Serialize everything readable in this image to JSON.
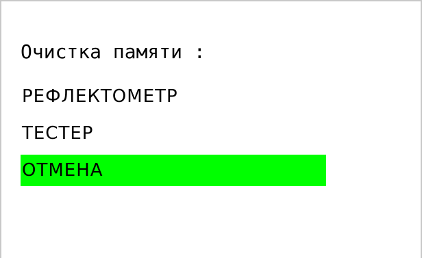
{
  "screen": {
    "title": "Очистка памяти :"
  },
  "menu": {
    "items": [
      {
        "label": "РЕФЛЕКТОМЕТР",
        "selected": false
      },
      {
        "label": "ТЕСТЕР",
        "selected": false
      },
      {
        "label": "ОТМЕНА",
        "selected": true
      }
    ]
  },
  "colors": {
    "background": "#ffffff",
    "text": "#000000",
    "selection_highlight": "#00ff00",
    "frame": "#c8c8c8"
  }
}
